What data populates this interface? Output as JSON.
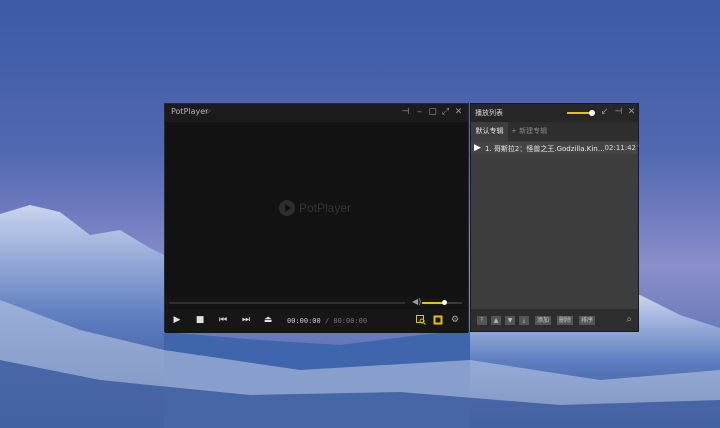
{
  "player": {
    "title": "PotPlayer",
    "logo_text": "PotPlayer",
    "time_current": "00:00:00",
    "time_separator": "/",
    "time_total": "00:00:00",
    "volume_level": 0.55
  },
  "playlist": {
    "title": "播放列表",
    "tabs": [
      "默认专辑",
      "+ 新建专辑"
    ],
    "items": [
      {
        "label": "1. 哥斯拉2：怪兽之王.Godzilla.King.of.t...",
        "duration": "02:11:42"
      }
    ],
    "buttons": [
      "添加",
      "删除",
      "排序"
    ]
  },
  "colors": {
    "accent": "#e6c200",
    "window_bg": "#121212",
    "playlist_bg": "#3d3d3d"
  }
}
